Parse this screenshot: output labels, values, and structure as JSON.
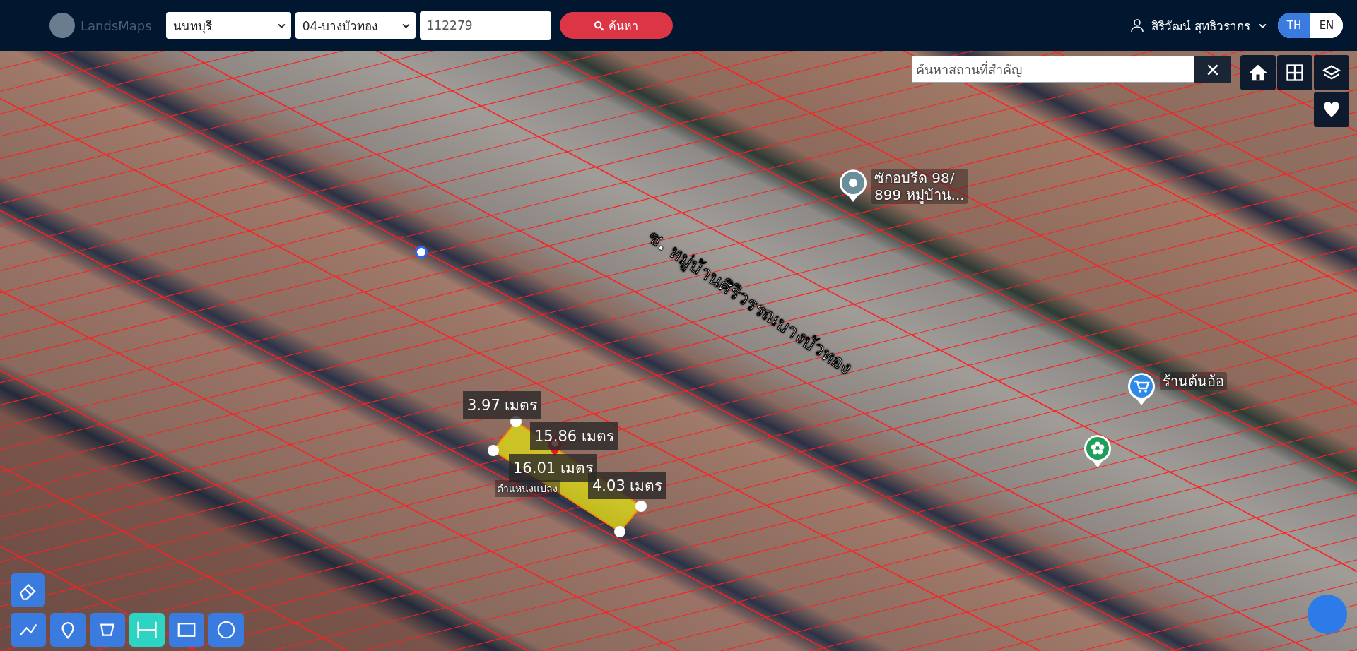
{
  "header": {
    "logo_text": "LandsMaps",
    "province_select": "นนทบุรี",
    "district_select": "04-บางบัวทอง",
    "parcel_input": "112279",
    "search_button": "ค้นหา",
    "user_name": "สิริวัฒน์ สุทธิวรากร",
    "languages": [
      {
        "label": "TH",
        "selected": true
      },
      {
        "label": "EN",
        "selected": false
      }
    ]
  },
  "map": {
    "place_search": {
      "placeholder": "ค้นหาสถานที่สำคัญ"
    },
    "road_label": "ซ. หมู่บ้านศิริวรรณบางบัวทอง",
    "pois": [
      {
        "kind": "laundry",
        "label": "ซักอบรีด 98/\n899 หมู่บ้าน..."
      },
      {
        "kind": "shop",
        "label": "ร้านต้นอ้อ"
      },
      {
        "kind": "park"
      }
    ],
    "measurements": [
      "3.97 เมตร",
      "15.86 เมตร",
      "16.01 เมตร",
      "4.03 เมตร"
    ],
    "parcel_label": "ตำแหน่งแปลง",
    "tools": [
      {
        "kind": "line",
        "selected": false
      },
      {
        "kind": "marker",
        "selected": false
      },
      {
        "kind": "polygon",
        "selected": false
      },
      {
        "kind": "distance",
        "selected": true
      },
      {
        "kind": "area",
        "selected": false
      },
      {
        "kind": "circle",
        "selected": false
      }
    ]
  }
}
